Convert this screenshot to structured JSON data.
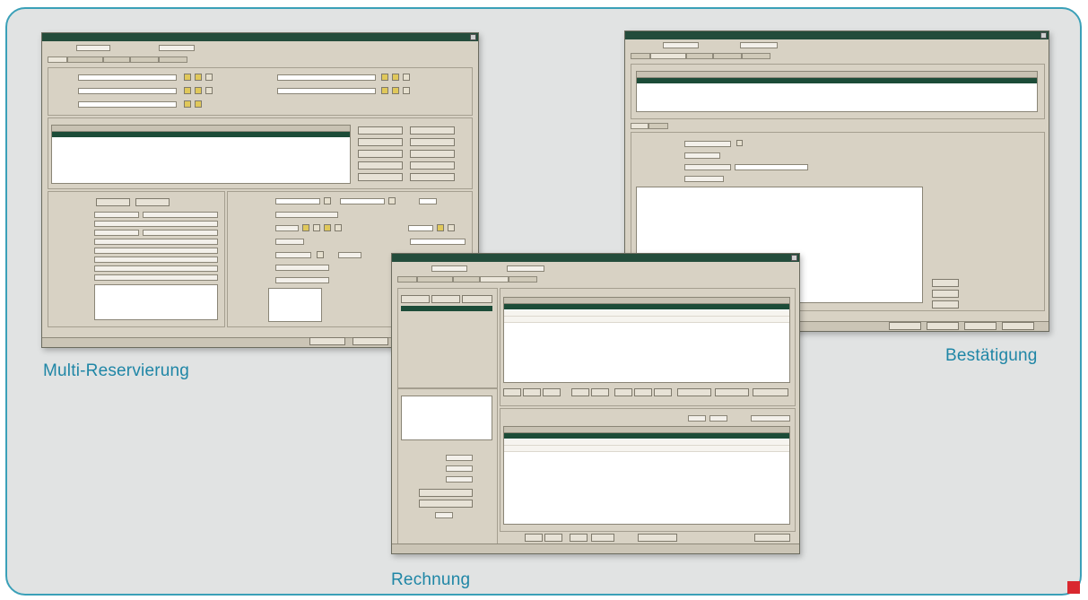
{
  "captions": {
    "multi": "Multi-Reservierung",
    "confirm": "Bestätigung",
    "invoice": "Rechnung"
  },
  "colors": {
    "frame_border": "#3aa0b8",
    "caption": "#1f86a6",
    "accent": "#d9282f",
    "selected_row": "#1c4c38"
  }
}
